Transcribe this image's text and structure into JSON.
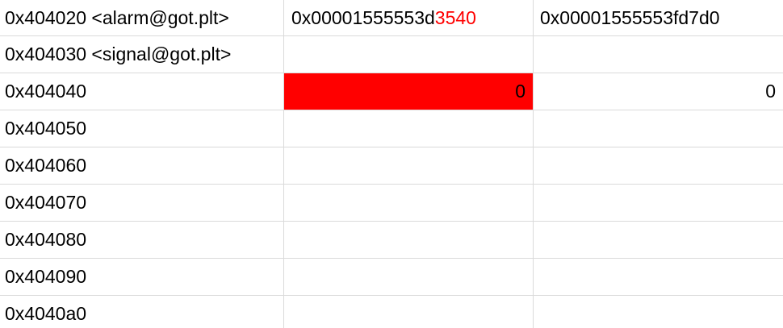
{
  "accent_color": "#ff0000",
  "rows": [
    {
      "address": "0x404020 <alarm@got.plt>",
      "col1": {
        "prefix": "0x00001555553d",
        "highlight": "3540"
      },
      "col2": "0x00001555553fd7d0"
    },
    {
      "address": "0x404030 <signal@got.plt>",
      "col1": "",
      "col2": ""
    },
    {
      "address": "0x404040",
      "col1": "0",
      "col2": "0"
    },
    {
      "address": "0x404050",
      "col1": "",
      "col2": ""
    },
    {
      "address": "0x404060",
      "col1": "",
      "col2": ""
    },
    {
      "address": "0x404070",
      "col1": "",
      "col2": ""
    },
    {
      "address": "0x404080",
      "col1": "",
      "col2": ""
    },
    {
      "address": "0x404090",
      "col1": "",
      "col2": ""
    },
    {
      "address": "0x4040a0",
      "col1": "",
      "col2": ""
    }
  ]
}
